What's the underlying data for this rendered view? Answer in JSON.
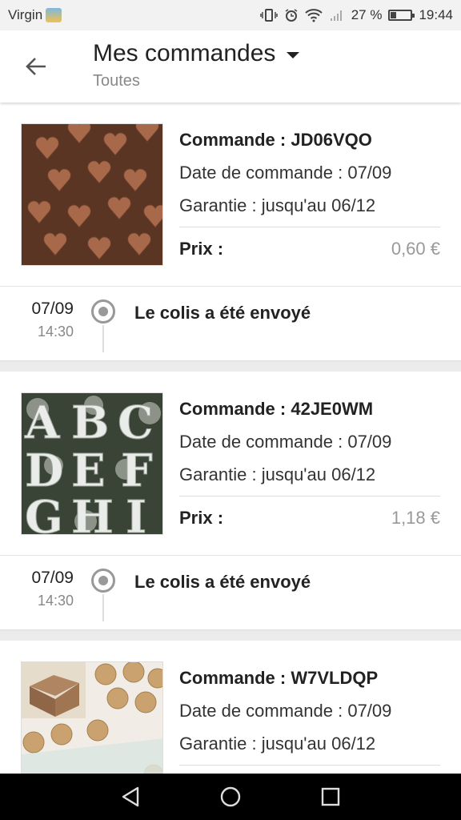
{
  "status_bar": {
    "carrier": "Virgin",
    "battery_text": "27 %",
    "battery_level": 0.27,
    "time": "19:44"
  },
  "header": {
    "title": "Mes commandes",
    "subtitle": "Toutes"
  },
  "orders": [
    {
      "command": "Commande : JD06VQO",
      "date": "Date de commande : 07/09",
      "guarantee": "Garantie : jusqu'au 06/12",
      "price_label": "Prix :",
      "price": "0,60 €",
      "track_date": "07/09",
      "track_time": "14:30",
      "track_status": "Le colis a été envoyé",
      "image": "wooden-hearts-image"
    },
    {
      "command": "Commande : 42JE0WM",
      "date": "Date de commande : 07/09",
      "guarantee": "Garantie : jusqu'au 06/12",
      "price_label": "Prix :",
      "price": "1,18 €",
      "track_date": "07/09",
      "track_time": "14:30",
      "track_status": "Le colis a été envoyé",
      "image": "letters-image"
    },
    {
      "command": "Commande : W7VLDQP",
      "date": "Date de commande : 07/09",
      "guarantee": "Garantie : jusqu'au 06/12",
      "image": "thank-you-stickers-image"
    }
  ],
  "colors": {
    "background": "#ececec",
    "card": "#ffffff",
    "muted": "#999999"
  }
}
